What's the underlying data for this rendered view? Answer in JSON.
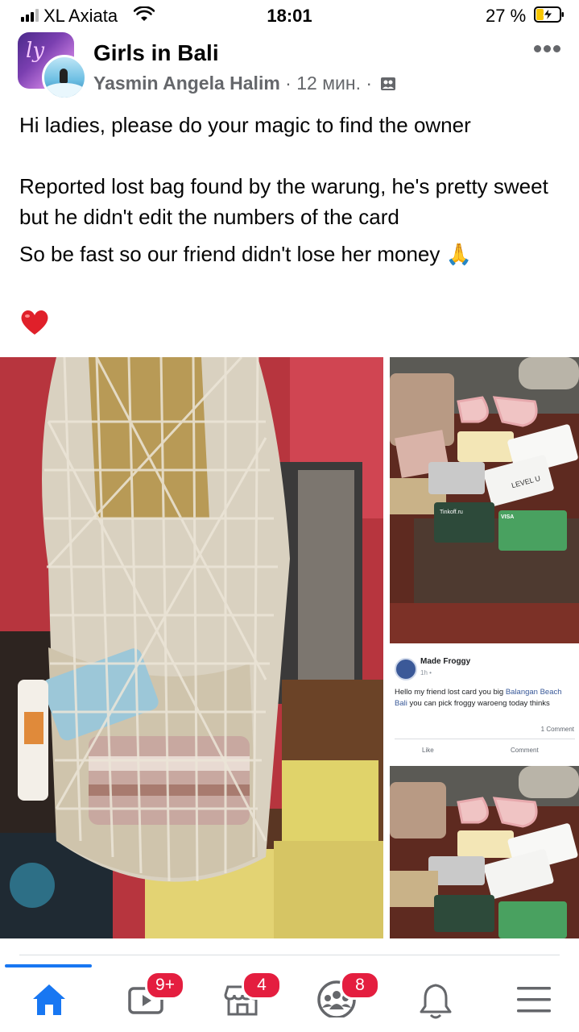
{
  "status_bar": {
    "carrier": "XL Axiata",
    "time": "18:01",
    "battery_percent": "27 %"
  },
  "post": {
    "group_name": "Girls in Bali",
    "author": "Yasmin Angela Halim",
    "time_ago": "12 мин.",
    "separator": " · ",
    "paragraphs": [
      "Hi ladies, please do your magic to find the owner",
      "Reported lost bag found by the warung, he's pretty sweet but he didn't edit the numbers of the card",
      "So be fast so our friend didn't lose her money 🙏"
    ]
  },
  "embedded_screenshot": {
    "name": "Made Froggy",
    "time": "1h •",
    "text_before": "Hello my friend lost card you big ",
    "link": "Balangan Beach Bali",
    "text_after": " you can pick froggy waroeng today thinks",
    "comments": "1 Comment",
    "like_label": "Like",
    "comment_label": "Comment"
  },
  "cards": {
    "brand_1": "LEVEL U",
    "brand_2": "VISA",
    "brand_3": "Tinkoff.ru"
  },
  "tab_bar": {
    "active_tab": "home",
    "badges": {
      "watch": "9+",
      "marketplace": "4",
      "groups": "8"
    }
  },
  "colors": {
    "accent": "#1877f2",
    "badge": "#e41e3f",
    "secondary_text": "#65676b"
  }
}
